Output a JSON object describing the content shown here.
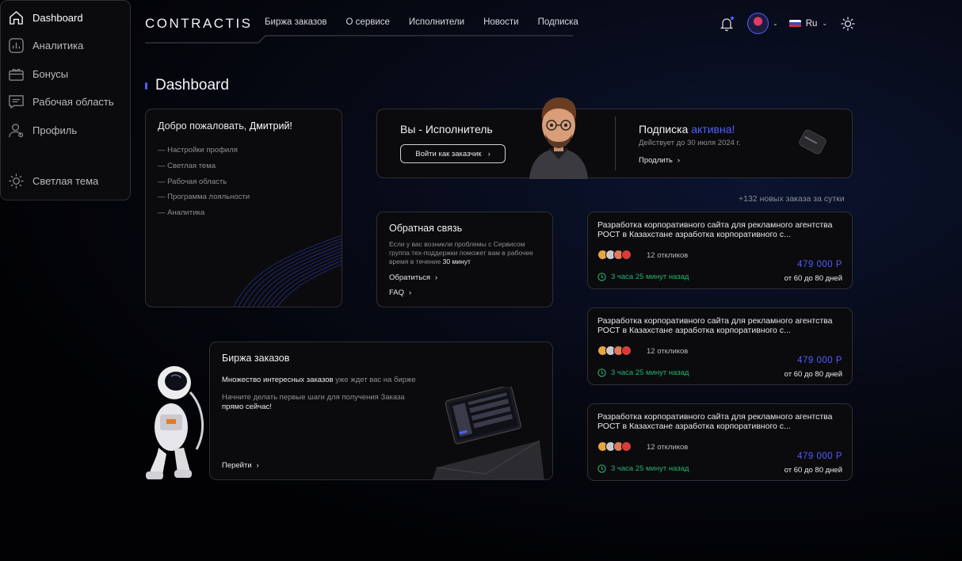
{
  "header": {
    "logo": "CONTRACTIS",
    "nav": [
      "Биржа заказов",
      "О сервисе",
      "Исполнители",
      "Новости",
      "Подписка"
    ],
    "lang": "Ru",
    "icons": [
      "bell-icon",
      "avatar",
      "sun-icon"
    ]
  },
  "page": {
    "title": "Dashboard"
  },
  "sidebar": {
    "items": [
      {
        "label": "Dashboard",
        "icon": "home-icon"
      },
      {
        "label": "Аналитика",
        "icon": "analytics-icon"
      },
      {
        "label": "Бонусы",
        "icon": "gift-icon"
      },
      {
        "label": "Рабочая область",
        "icon": "chat-icon"
      },
      {
        "label": "Профиль",
        "icon": "user-icon"
      }
    ],
    "theme_toggle": "Светлая тема"
  },
  "welcome": {
    "greeting": "Добро пожаловать,",
    "name": "Дмитрий!",
    "links": [
      "— Настройки профиля",
      "— Светлая тема",
      "— Рабочая область",
      "— Программа лояльности",
      "— Аналитика"
    ]
  },
  "role": {
    "title": "Вы - Исполнитель",
    "button": "Войти как заказчик",
    "subscription_prefix": "Подписка",
    "subscription_status": "активна!",
    "valid_until": "Действует до 30 июля 2024 г.",
    "extend": "Продлить"
  },
  "orders_count": "+132 новых заказа за сутки",
  "feedback": {
    "title": "Обратная связь",
    "text": "Если у вас возникли проблемы с Сервисом группа тех-поддержки поможет вам в рабочее время в течение",
    "text_bold": "30 минут",
    "contact": "Обратиться",
    "faq": "FAQ"
  },
  "exchange": {
    "title": "Биржа заказов",
    "line1_bold": "Множество интересных заказов",
    "line1_rest": "уже ждет вас на бирже",
    "line2": "Начните делать первые шаги для получения Заказа",
    "line2_bold": "прямо сейчас!",
    "go": "Перейти"
  },
  "orders": [
    {
      "title": "Разработка корпоративного сайта для рекламного агентства РОСТ в Казахстане азработка корпоративного с...",
      "responses": "12 откликов",
      "price": "479 000 Р",
      "time": "3 часа 25 минут назад",
      "duration": "от 60 до 80 дней"
    },
    {
      "title": "Разработка корпоративного сайта для рекламного агентства РОСТ в Казахстане азработка корпоративного с...",
      "responses": "12 откликов",
      "price": "479 000 Р",
      "time": "3 часа 25 минут назад",
      "duration": "от 60 до 80 дней"
    },
    {
      "title": "Разработка корпоративного сайта для рекламного агентства РОСТ в Казахстане азработка корпоративного с...",
      "responses": "12 откликов",
      "price": "479 000 Р",
      "time": "3 часа 25 минут назад",
      "duration": "от 60 до 80 дней"
    }
  ],
  "colors": {
    "accent": "#4d5fff",
    "success": "#27b370",
    "background": "#050508",
    "card": "#0b0b0e"
  }
}
